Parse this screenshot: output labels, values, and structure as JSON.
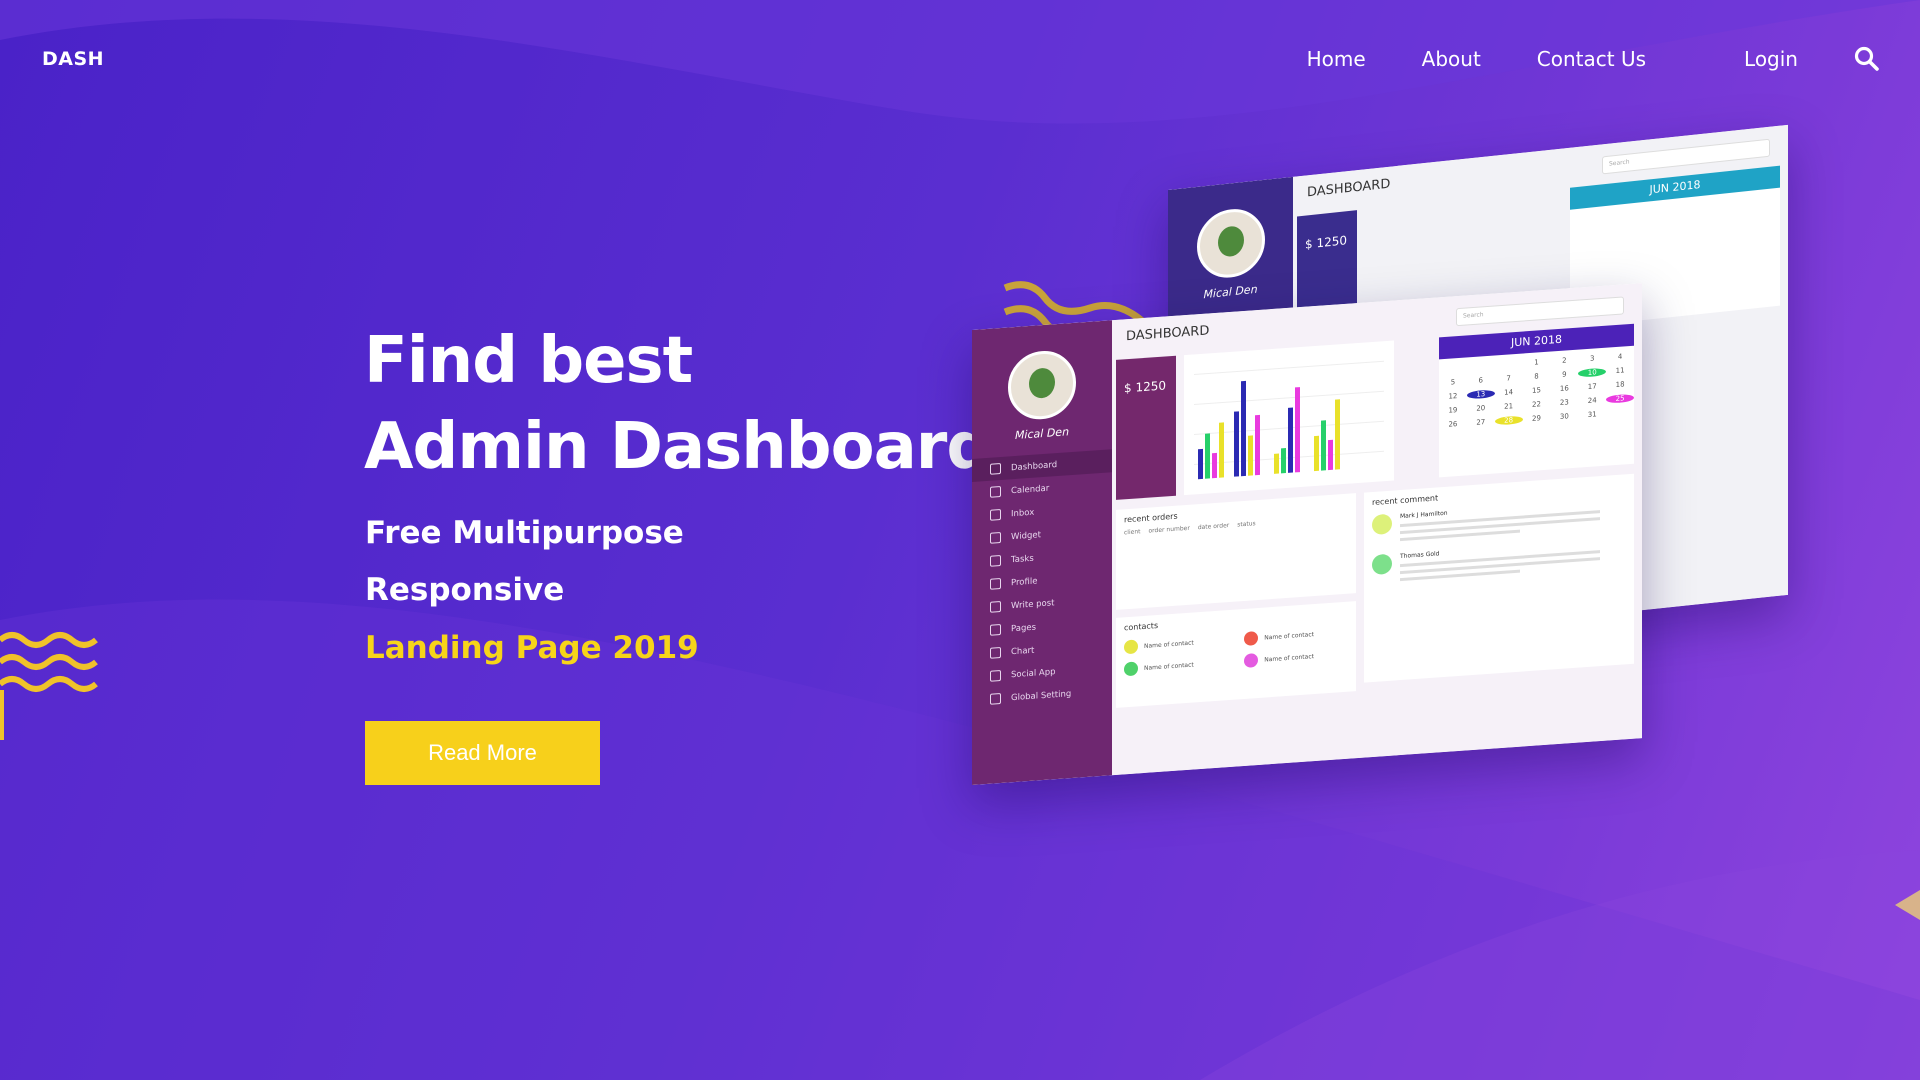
{
  "brand": "DASH",
  "nav": {
    "items": [
      "Home",
      "About",
      "Contact Us"
    ],
    "login": "Login",
    "search_icon": "search-icon"
  },
  "hero": {
    "title_line1": "Find best",
    "title_line2": "Admin Dashboard",
    "sub1": "Free Multipurpose",
    "sub2": "Responsive",
    "sub3": "Landing Page 2019",
    "cta": "Read More"
  },
  "mockup": {
    "user_name": "Mical Den",
    "dashboard_title": "DASHBOARD",
    "search_placeholder": "Search",
    "income_amount": "$ 1250",
    "calendar_title": "JUN  2018",
    "calendar_days": [
      "",
      "",
      "",
      "1",
      "2",
      "3",
      "4",
      "5",
      "6",
      "7",
      "8",
      "9",
      "10",
      "11",
      "12",
      "13",
      "14",
      "15",
      "16",
      "17",
      "18",
      "19",
      "20",
      "21",
      "22",
      "23",
      "24",
      "25",
      "26",
      "27",
      "28",
      "29",
      "30",
      "31",
      "",
      "",
      ""
    ],
    "menu": [
      "Dashboard",
      "Calendar",
      "Inbox",
      "Widget",
      "Tasks",
      "Profile",
      "Write post",
      "Pages",
      "Chart",
      "Social App",
      "Global Setting"
    ],
    "orders_title": "recent orders",
    "orders_headers": [
      "client",
      "order number",
      "date order",
      "status"
    ],
    "comments_title": "recent comment",
    "comment_authors": [
      "Mark J Hamilton",
      "Thomas Gold"
    ],
    "contacts_title": "contacts",
    "contact_label": "Name of contact"
  },
  "colors": {
    "accent_yellow": "#f7d01b",
    "background_purple": "#5a2ed0",
    "sidebar_purple": "#6e2770"
  }
}
